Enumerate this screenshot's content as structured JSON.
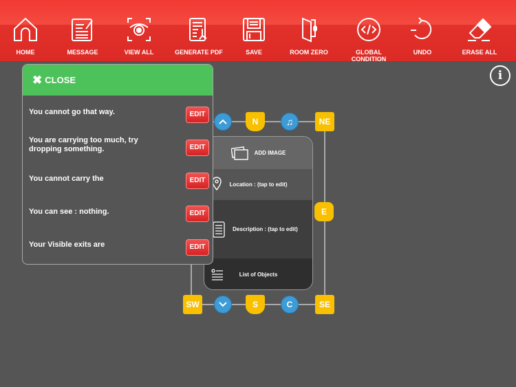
{
  "toolbar": {
    "items": [
      {
        "label": "HOME",
        "icon": "home-icon"
      },
      {
        "label": "MESSAGE",
        "icon": "message-icon"
      },
      {
        "label": "VIEW ALL",
        "icon": "eye-icon"
      },
      {
        "label": "GENERATE PDF",
        "icon": "pdf-icon"
      },
      {
        "label": "SAVE",
        "icon": "save-icon"
      },
      {
        "label": "ROOM ZERO",
        "icon": "door-icon"
      },
      {
        "label": "GLOBAL CONDITION",
        "icon": "code-icon"
      },
      {
        "label": "UNDO",
        "icon": "undo-icon"
      },
      {
        "label": "ERASE ALL",
        "icon": "eraser-icon"
      }
    ]
  },
  "info_label": "i",
  "panel": {
    "close_label": "CLOSE",
    "edit_label": "EDIT",
    "messages": [
      "You cannot go that way.",
      "You are carrying too much, try dropping something.",
      "You cannot carry the",
      "You can see : nothing.",
      "Your Visible exits are"
    ]
  },
  "room": {
    "add_image": "ADD IMAGE",
    "location": "Location : (tap to edit)",
    "description": "Description : (tap to edit)",
    "objects": "List of Objects"
  },
  "exits": {
    "n": "N",
    "ne": "NE",
    "e": "E",
    "se": "SE",
    "s": "S",
    "sw": "SW",
    "c": "C"
  },
  "colors": {
    "toolbar": "#e8322c",
    "close_header": "#4dc25a",
    "exit_yellow": "#f8c000",
    "exit_blue": "#3d9bd6",
    "edit": "#e02a2a"
  }
}
